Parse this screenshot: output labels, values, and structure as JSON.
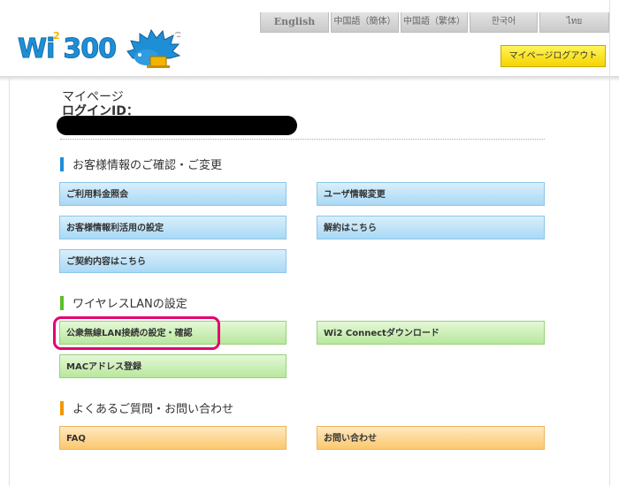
{
  "header": {
    "languages": [
      "English",
      "中国語（簡体）",
      "中国語（繁体）",
      "한국어",
      "ไทย"
    ],
    "logo_text": "Wi",
    "logo_sup": "2",
    "logo_suffix": "300",
    "logout_label": "マイページログアウト"
  },
  "account": {
    "title": "マイページ",
    "login_id_label": "ログインID："
  },
  "sections": [
    {
      "heading": "お客様情報のご確認・ご変更",
      "color": "#1e8fd6",
      "buttons": [
        "ご利用料金照会",
        "ユーザ情報変更",
        "お客様情報利活用の設定",
        "解約はこちら",
        "ご契約内容はこちら"
      ]
    },
    {
      "heading": "ワイヤレスLANの設定",
      "color": "#5cbf2a",
      "buttons": [
        "公衆無線LAN接続の設定・確認",
        "Wi2 Connectダウンロード",
        "MACアドレス登録"
      ]
    },
    {
      "heading": "よくあるご質問・お問い合わせ",
      "color": "#f39800",
      "buttons": [
        "FAQ",
        "お問い合わせ"
      ]
    }
  ]
}
